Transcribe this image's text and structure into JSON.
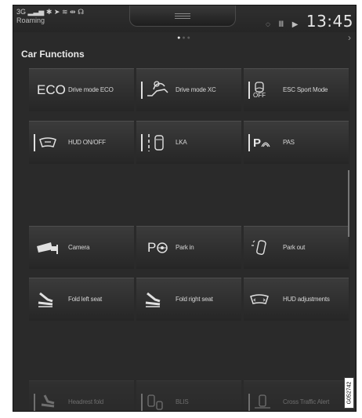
{
  "status": {
    "network": "3G",
    "signal_icon": "signal-bars-icon",
    "roaming": "Roaming",
    "clock": "13:45"
  },
  "page_indicator": {
    "pages": 3,
    "current": 1
  },
  "section_title": "Car Functions",
  "tiles": [
    {
      "label": "Drive mode ECO",
      "icon": "eco-text-icon",
      "icon_text": "ECO",
      "enabled": true
    },
    {
      "label": "Drive mode XC",
      "icon": "offroad-car-icon",
      "enabled": true
    },
    {
      "label": "ESC Sport Mode",
      "icon": "esc-off-icon",
      "icon_text": "OFF",
      "enabled": true
    },
    {
      "label": "HUD ON/OFF",
      "icon": "hud-icon",
      "enabled": true
    },
    {
      "label": "LKA",
      "icon": "lane-keeping-icon",
      "enabled": true
    },
    {
      "label": "PAS",
      "icon": "park-assist-icon",
      "icon_text": "P",
      "enabled": true
    },
    {
      "label": "Camera",
      "icon": "camera-icon",
      "enabled": true
    },
    {
      "label": "Park in",
      "icon": "park-in-icon",
      "icon_text": "P",
      "enabled": true
    },
    {
      "label": "Park out",
      "icon": "park-out-icon",
      "enabled": true
    },
    {
      "label": "Fold left seat",
      "icon": "fold-left-seat-icon",
      "enabled": true
    },
    {
      "label": "Fold right seat",
      "icon": "fold-right-seat-icon",
      "enabled": true
    },
    {
      "label": "HUD adjustments",
      "icon": "hud-adjust-icon",
      "enabled": true
    },
    {
      "label": "Headrest fold",
      "icon": "headrest-fold-icon",
      "enabled": false
    },
    {
      "label": "BLIS",
      "icon": "blis-icon",
      "enabled": false
    },
    {
      "label": "Cross Traffic Alert",
      "icon": "cross-traffic-icon",
      "enabled": false
    }
  ],
  "image_code": "G052742"
}
